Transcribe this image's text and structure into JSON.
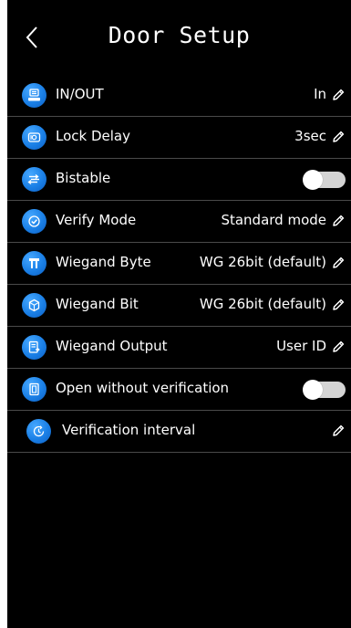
{
  "header": {
    "title": "Door Setup",
    "back_icon": "chevron-left-icon"
  },
  "colors": {
    "background": "#000000",
    "icon_blue": "#1a7fe6",
    "divider": "#4a4a4a",
    "toggle_off": "#d4d4d4"
  },
  "rows": [
    {
      "label": "IN/OUT",
      "value": "In",
      "icon": "in-out-icon",
      "control": "edit"
    },
    {
      "label": "Lock Delay",
      "value": "3sec",
      "icon": "lock-delay-icon",
      "control": "edit"
    },
    {
      "label": "Bistable",
      "value": "",
      "icon": "bistable-icon",
      "control": "toggle",
      "toggle_on": false
    },
    {
      "label": "Verify Mode",
      "value": "Standard mode",
      "icon": "verify-mode-icon",
      "control": "edit"
    },
    {
      "label": "Wiegand Byte",
      "value": "WG 26bit (default)",
      "icon": "wiegand-byte-icon",
      "control": "edit"
    },
    {
      "label": "Wiegand Bit",
      "value": "WG 26bit (default)",
      "icon": "wiegand-bit-icon",
      "control": "edit"
    },
    {
      "label": "Wiegand Output",
      "value": "User ID",
      "icon": "wiegand-output-icon",
      "control": "edit"
    },
    {
      "label": "Open without verification",
      "value": "",
      "icon": "open-without-verification-icon",
      "control": "toggle",
      "toggle_on": false
    },
    {
      "label": "Verification interval",
      "value": "",
      "icon": "verification-interval-icon",
      "control": "edit"
    }
  ]
}
